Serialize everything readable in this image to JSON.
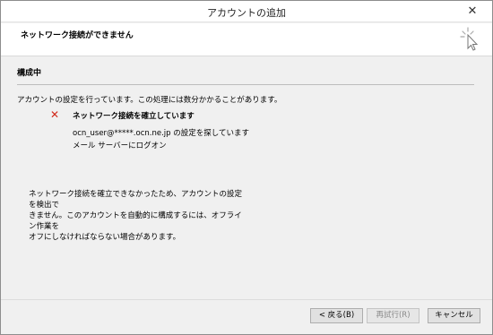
{
  "window": {
    "title": "アカウントの追加",
    "close_glyph": "✕"
  },
  "header": {
    "heading": "ネットワーク接続ができません",
    "icon": "wizard-cursor-icon"
  },
  "main": {
    "section_title": "構成中",
    "description": "アカウントの設定を行っています。この処理には数分かかることがあります。",
    "steps": [
      {
        "text": "ネットワーク接続を確立しています",
        "status": "failed",
        "icon": "fail-x-icon"
      },
      {
        "text": "ocn_user@*****.ocn.ne.jp の設定を探しています"
      },
      {
        "text": "メール サーバーにログオン"
      }
    ],
    "error_lines": [
      "ネットワーク接続を確立できなかったため、アカウントの設定を検出で",
      "きません。このアカウントを自動的に構成するには、オフライン作業を",
      "オフにしなければならない場合があります。"
    ]
  },
  "buttons": {
    "back": "< 戻る(B)",
    "retry": "再試行(R)",
    "cancel": "キャンセル"
  },
  "colors": {
    "fail": "#d12a1c",
    "background": "#f0f0f0"
  }
}
